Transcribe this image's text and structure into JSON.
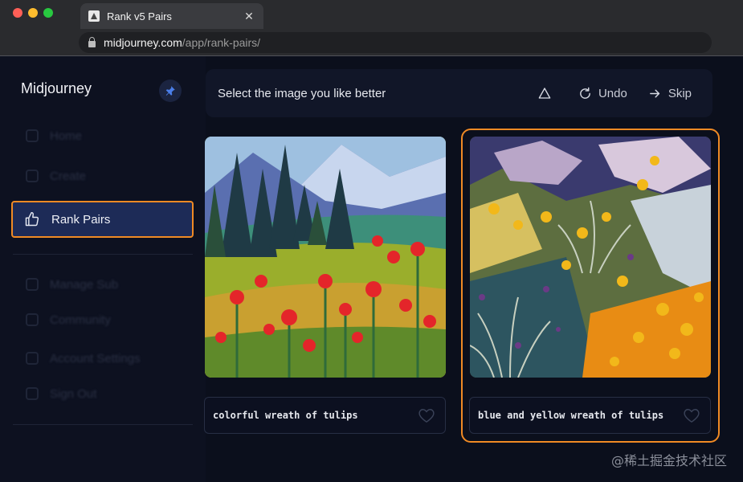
{
  "browser": {
    "tab_title": "Rank v5 Pairs",
    "tab_close": "✕",
    "url_domain": "midjourney.com",
    "url_path": "/app/rank-pairs/",
    "traffic_colors": [
      "#ff5f57",
      "#febc2e",
      "#28c840"
    ]
  },
  "sidebar": {
    "brand": "Midjourney",
    "pin_icon": "pin-icon",
    "items": [
      {
        "label": "Home",
        "icon": "home-icon",
        "state": "blurred"
      },
      {
        "label": "Create",
        "icon": "create-icon",
        "state": "blurred"
      },
      {
        "label": "Rank Pairs",
        "icon": "thumbs-up-icon",
        "state": "active"
      },
      {
        "label": "Manage Sub",
        "icon": "card-icon",
        "state": "blurred"
      },
      {
        "label": "Community",
        "icon": "users-icon",
        "state": "blurred"
      },
      {
        "label": "Account Settings",
        "icon": "settings-icon",
        "state": "blurred"
      },
      {
        "label": "Sign Out",
        "icon": "signout-icon",
        "state": "blurred"
      }
    ]
  },
  "toolbar": {
    "prompt": "Select the image you like better",
    "warn_icon": "warning-icon",
    "undo_label": "Undo",
    "skip_label": "Skip"
  },
  "pair": [
    {
      "caption": "colorful wreath of tulips",
      "selected": false
    },
    {
      "caption": "blue and yellow wreath of tulips",
      "selected": true
    }
  ],
  "colors": {
    "accent": "#f08a24",
    "active_bg": "#1d2b57"
  },
  "watermark": "@稀土掘金技术社区"
}
